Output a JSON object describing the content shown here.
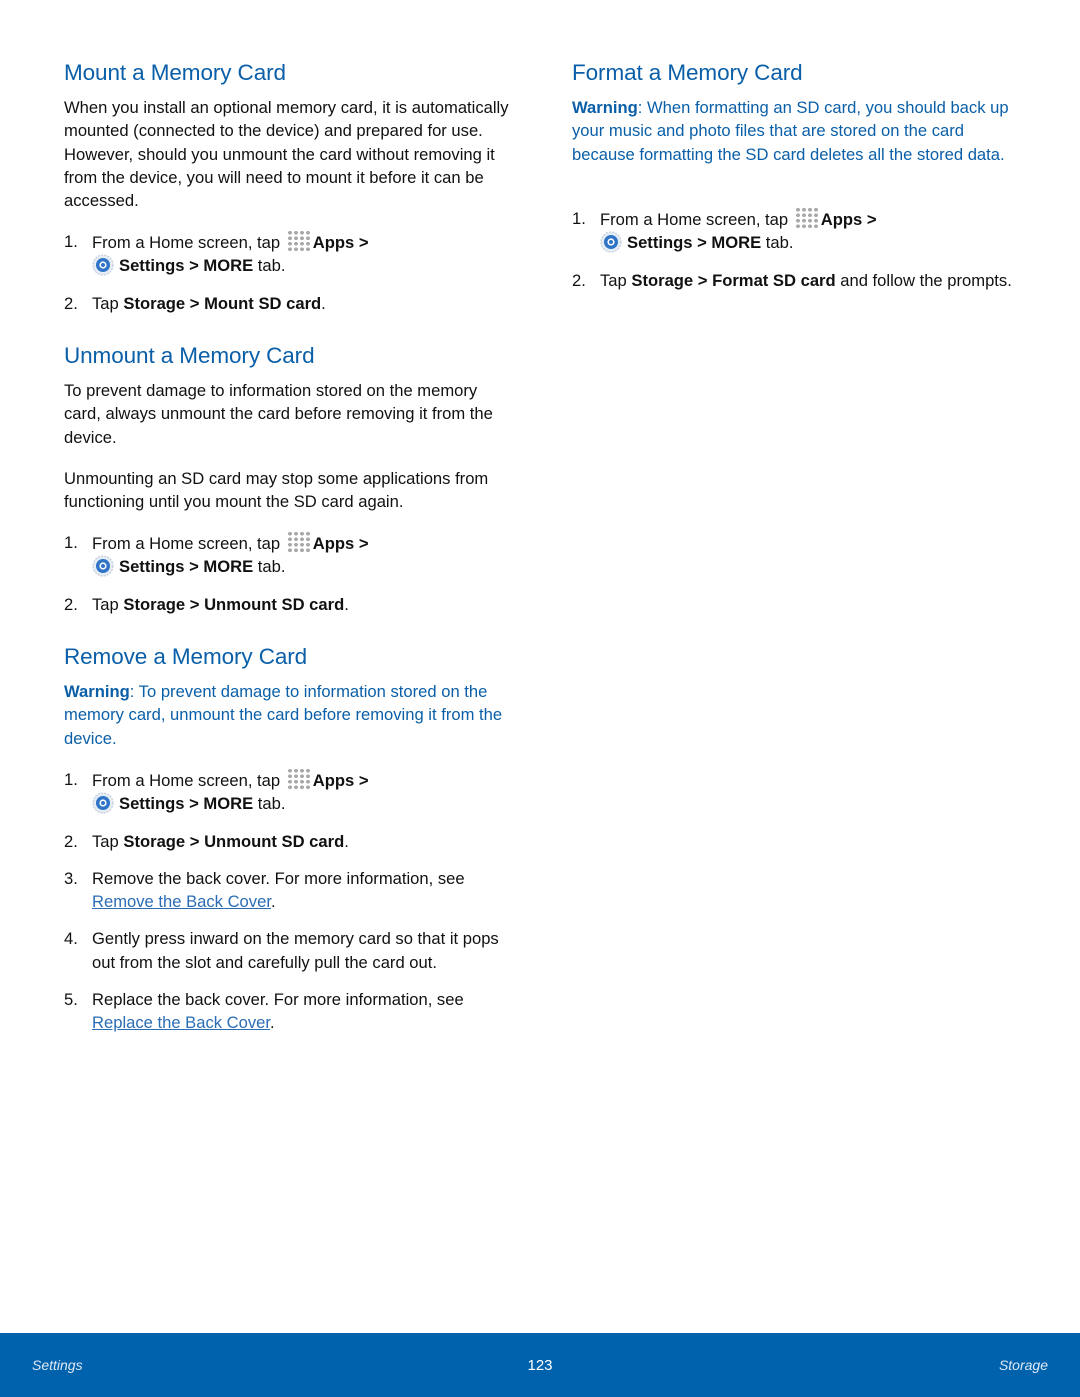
{
  "left": {
    "mount": {
      "title": "Mount a Memory Card",
      "body": "When you install an optional memory card, it is automatically mounted (connected to the device) and prepared for use. However, should you unmount the card without removing it from the device, you will need to mount it before it can be accessed.",
      "steps": [
        {
          "num": "1.",
          "pre": "From a Home screen, tap ",
          "apps": "Apps",
          "sep1": " > ",
          "settings": "Settings",
          "sep2": " > ",
          "more": "MORE",
          "post": " tab."
        },
        {
          "num": "2.",
          "pre": "Tap ",
          "b1": "Storage",
          "sep": " > ",
          "b2": "Mount SD card",
          "post": "."
        }
      ]
    },
    "unmount": {
      "title": "Unmount a Memory Card",
      "body1": "To prevent damage to information stored on the memory card, always unmount the card before removing it from the device.",
      "body2": "Unmounting an SD card may stop some applications from functioning until you mount the SD card again.",
      "steps": [
        {
          "num": "1.",
          "pre": "From a Home screen, tap ",
          "apps": "Apps",
          "sep1": " > ",
          "settings": "Settings",
          "sep2": " > ",
          "more": "MORE",
          "post": " tab."
        },
        {
          "num": "2.",
          "pre": "Tap ",
          "b1": "Storage",
          "sep": " > ",
          "b2": "Unmount SD card",
          "post": "."
        }
      ]
    },
    "remove": {
      "title": "Remove a Memory Card",
      "warning_label": "Warning",
      "warning_text": ": To prevent damage to information stored on the memory card, unmount the card before removing it from the device.",
      "steps": [
        {
          "num": "1.",
          "pre": "From a Home screen, tap ",
          "apps": "Apps",
          "sep1": " > ",
          "settings": "Settings",
          "sep2": " > ",
          "more": "MORE",
          "post": " tab."
        },
        {
          "num": "2.",
          "pre": "Tap ",
          "b1": "Storage",
          "sep": " > ",
          "b2": "Unmount SD card",
          "post": "."
        },
        {
          "num": "3.",
          "pre": "Remove the back cover. For more information, see ",
          "link": "Remove the Back Cover",
          "post": "."
        },
        {
          "num": "4.",
          "text": "Gently press inward on the memory card so that it pops out from the slot and carefully pull the card out."
        },
        {
          "num": "5.",
          "pre": "Replace the back cover. For more information, see ",
          "link": "Replace the Back Cover",
          "post": "."
        }
      ]
    }
  },
  "right": {
    "format": {
      "title": "Format a Memory Card",
      "warning_label": "Warning",
      "warning_text": ": When formatting an SD card, you should back up your music and photo files that are stored on the card because formatting the SD card deletes all the stored data.",
      "steps": [
        {
          "num": "1.",
          "pre": "From a Home screen, tap ",
          "apps": "Apps",
          "sep1": " > ",
          "settings": "Settings",
          "sep2": " > ",
          "more": "MORE",
          "post": " tab."
        },
        {
          "num": "2.",
          "pre": "Tap ",
          "b1": "Storage",
          "sep": " > ",
          "b2": "Format SD card",
          "post": " and follow the prompts."
        }
      ]
    }
  },
  "footer": {
    "left": "Settings",
    "page": "123",
    "right": "Storage"
  },
  "colors": {
    "heading": "#0a5fa8",
    "footer_bg": "#0062ad",
    "link": "#2a6db5"
  }
}
